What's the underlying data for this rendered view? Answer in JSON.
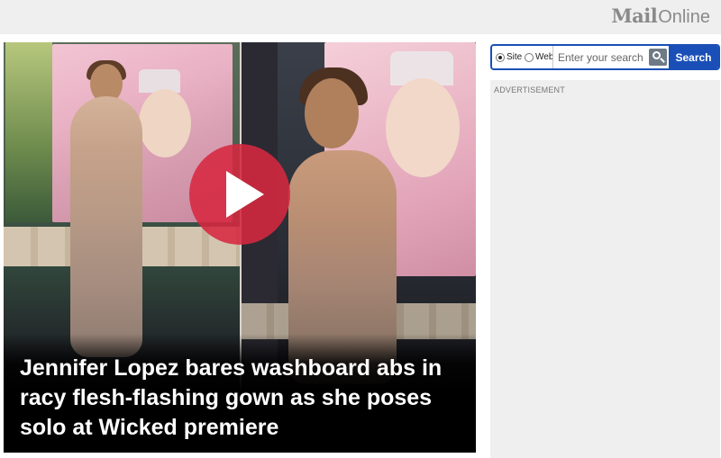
{
  "header": {
    "logo_bold": "Mail",
    "logo_light": "Online"
  },
  "video": {
    "headline": "Jennifer Lopez bares washboard abs in racy flesh-flashing gown as she poses solo at Wicked premiere",
    "play_icon": "play-icon",
    "play_color": "#d62840"
  },
  "search": {
    "scope_options": [
      "Site",
      "Web"
    ],
    "selected_scope": "Site",
    "placeholder": "Enter your search",
    "button_label": "Search",
    "accent": "#1a4fb7"
  },
  "sidebar": {
    "ad_label": "ADVERTISEMENT"
  }
}
